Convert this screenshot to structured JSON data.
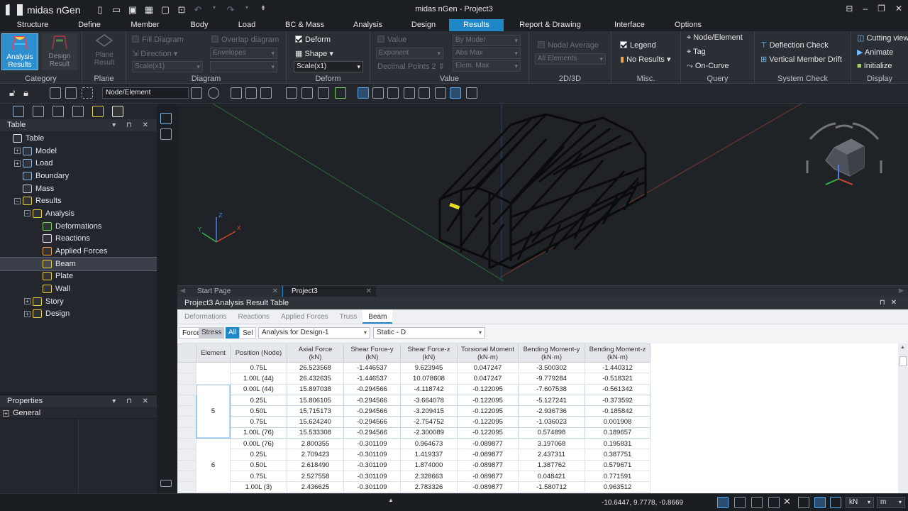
{
  "app": {
    "brand": "midas nGen",
    "window_title": "midas nGen - Project3"
  },
  "menu": [
    "Structure",
    "Define",
    "Member",
    "Body",
    "Load",
    "BC & Mass",
    "Analysis",
    "Design",
    "Results",
    "Report & Drawing",
    "Interface",
    "Options"
  ],
  "menu_active": "Results",
  "ribbon": {
    "category": {
      "label": "Category",
      "btn1": "Analysis Results",
      "btn2": "Design Result"
    },
    "plane": {
      "label": "Plane",
      "btn": "Plane Result"
    },
    "diagram": {
      "label": "Diagram",
      "fill": "Fill Diagram",
      "direction": "Direction",
      "scale": "Scale(x1)",
      "overlap": "Overlap diagram",
      "envelopes": "Envelopes"
    },
    "deform": {
      "label": "Deform",
      "deform": "Deform",
      "shape": "Shape",
      "scale": "Scale(x1)"
    },
    "value": {
      "label": "Value",
      "value": "Value",
      "exponent": "Exponent",
      "decimal": "Decimal Points",
      "decimal_val": "2",
      "by_model": "By Model",
      "abs_max": "Abs Max",
      "elem_max": "Elem. Max"
    },
    "twod3d": {
      "label": "2D/3D",
      "nodal": "Nodal Average",
      "all_elements": "All Elements"
    },
    "misc": {
      "label": "Misc.",
      "legend": "Legend",
      "no_results": "No Results"
    },
    "query": {
      "label": "Query",
      "node_element": "Node/Element",
      "tag": "Tag",
      "on_curve": "On-Curve"
    },
    "system_check": {
      "label": "System Check",
      "deflection": "Deflection Check",
      "drift": "Vertical Member Drift"
    },
    "display": {
      "label": "Display",
      "cutting": "Cutting view",
      "animate": "Animate",
      "initialize": "Initialize"
    }
  },
  "toolbar": {
    "selection_filter": "Node/Element"
  },
  "tree": {
    "panel_title": "Table",
    "items": [
      {
        "label": "Table",
        "indent": 0,
        "icon": "table-icon",
        "pm": ""
      },
      {
        "label": "Model",
        "indent": 1,
        "icon": "model-icon",
        "pm": "+"
      },
      {
        "label": "Load",
        "indent": 1,
        "icon": "load-icon",
        "pm": "+"
      },
      {
        "label": "Boundary",
        "indent": 1,
        "icon": "boundary-icon",
        "pm": ""
      },
      {
        "label": "Mass",
        "indent": 1,
        "icon": "mass-icon",
        "pm": ""
      },
      {
        "label": "Results",
        "indent": 1,
        "icon": "results-icon",
        "pm": "−"
      },
      {
        "label": "Analysis",
        "indent": 2,
        "icon": "analysis-icon",
        "pm": "−"
      },
      {
        "label": "Deformations",
        "indent": 3,
        "icon": "deformations-icon",
        "pm": ""
      },
      {
        "label": "Reactions",
        "indent": 3,
        "icon": "reactions-icon",
        "pm": ""
      },
      {
        "label": "Applied Forces",
        "indent": 3,
        "icon": "applied-forces-icon",
        "pm": ""
      },
      {
        "label": "Beam",
        "indent": 3,
        "icon": "beam-icon",
        "pm": "",
        "selected": true
      },
      {
        "label": "Plate",
        "indent": 3,
        "icon": "plate-icon",
        "pm": ""
      },
      {
        "label": "Wall",
        "indent": 3,
        "icon": "wall-icon",
        "pm": ""
      },
      {
        "label": "Story",
        "indent": 2,
        "icon": "story-icon",
        "pm": "+"
      },
      {
        "label": "Design",
        "indent": 2,
        "icon": "design-icon",
        "pm": "+"
      }
    ]
  },
  "properties": {
    "panel_title": "Properties",
    "section": "General"
  },
  "doc_tabs": [
    {
      "label": "Start Page"
    },
    {
      "label": "Project3",
      "active": true
    }
  ],
  "result_table": {
    "title": "Project3 Analysis Result Table",
    "tabs": [
      "Deformations",
      "Reactions",
      "Applied Forces",
      "Truss",
      "Beam"
    ],
    "active_tab": "Beam",
    "mode_force": "Force",
    "mode_stress": "Stress",
    "all_btn": "All",
    "sel_btn": "Sel",
    "analysis_select": "Analysis for Design-1",
    "case_select": "Static - D",
    "columns": [
      {
        "title": "Element",
        "unit": ""
      },
      {
        "title": "Position (Node)",
        "unit": ""
      },
      {
        "title": "Axial Force",
        "unit": "(kN)"
      },
      {
        "title": "Shear Force-y",
        "unit": "(kN)"
      },
      {
        "title": "Shear Force-z",
        "unit": "(kN)"
      },
      {
        "title": "Torsional Moment",
        "unit": "(kN·m)"
      },
      {
        "title": "Bending Moment-y",
        "unit": "(kN·m)"
      },
      {
        "title": "Bending Moment-z",
        "unit": "(kN·m)"
      }
    ],
    "groups": [
      {
        "element": "",
        "rows": [
          [
            "0.75L",
            "26.523568",
            "-1.446537",
            "9.623945",
            "0.047247",
            "-3.500302",
            "-1.440312"
          ],
          [
            "1.00L (44)",
            "26.432635",
            "-1.446537",
            "10.078608",
            "0.047247",
            "-9.779284",
            "-0.518321"
          ]
        ]
      },
      {
        "element": "5",
        "selected": true,
        "rows": [
          [
            "0.00L (44)",
            "15.897038",
            "-0.294566",
            "-4.118742",
            "-0.122095",
            "-7.607538",
            "-0.561342"
          ],
          [
            "0.25L",
            "15.806105",
            "-0.294566",
            "-3.664078",
            "-0.122095",
            "-5.127241",
            "-0.373592"
          ],
          [
            "0.50L",
            "15.715173",
            "-0.294566",
            "-3.209415",
            "-0.122095",
            "-2.936736",
            "-0.185842"
          ],
          [
            "0.75L",
            "15.624240",
            "-0.294566",
            "-2.754752",
            "-0.122095",
            "-1.036023",
            "0.001908"
          ],
          [
            "1.00L (76)",
            "15.533308",
            "-0.294566",
            "-2.300089",
            "-0.122095",
            "0.574898",
            "0.189657"
          ]
        ]
      },
      {
        "element": "6",
        "rows": [
          [
            "0.00L (76)",
            "2.800355",
            "-0.301109",
            "0.964673",
            "-0.089877",
            "3.197068",
            "0.195831"
          ],
          [
            "0.25L",
            "2.709423",
            "-0.301109",
            "1.419337",
            "-0.089877",
            "2.437311",
            "0.387751"
          ],
          [
            "0.50L",
            "2.618490",
            "-0.301109",
            "1.874000",
            "-0.089877",
            "1.387762",
            "0.579671"
          ],
          [
            "0.75L",
            "2.527558",
            "-0.301109",
            "2.328663",
            "-0.089877",
            "0.048421",
            "0.771591"
          ],
          [
            "1.00L (3)",
            "2.436625",
            "-0.301109",
            "2.783326",
            "-0.089877",
            "-1.580712",
            "0.963512"
          ]
        ]
      }
    ]
  },
  "status": {
    "coords": "-10.6447, 9.7778, -0.8669",
    "unit_force": "kN",
    "unit_length": "m"
  },
  "colors": {
    "accent": "#1f86c8",
    "bg": "#1e2126",
    "viewport": "#1f2328"
  }
}
